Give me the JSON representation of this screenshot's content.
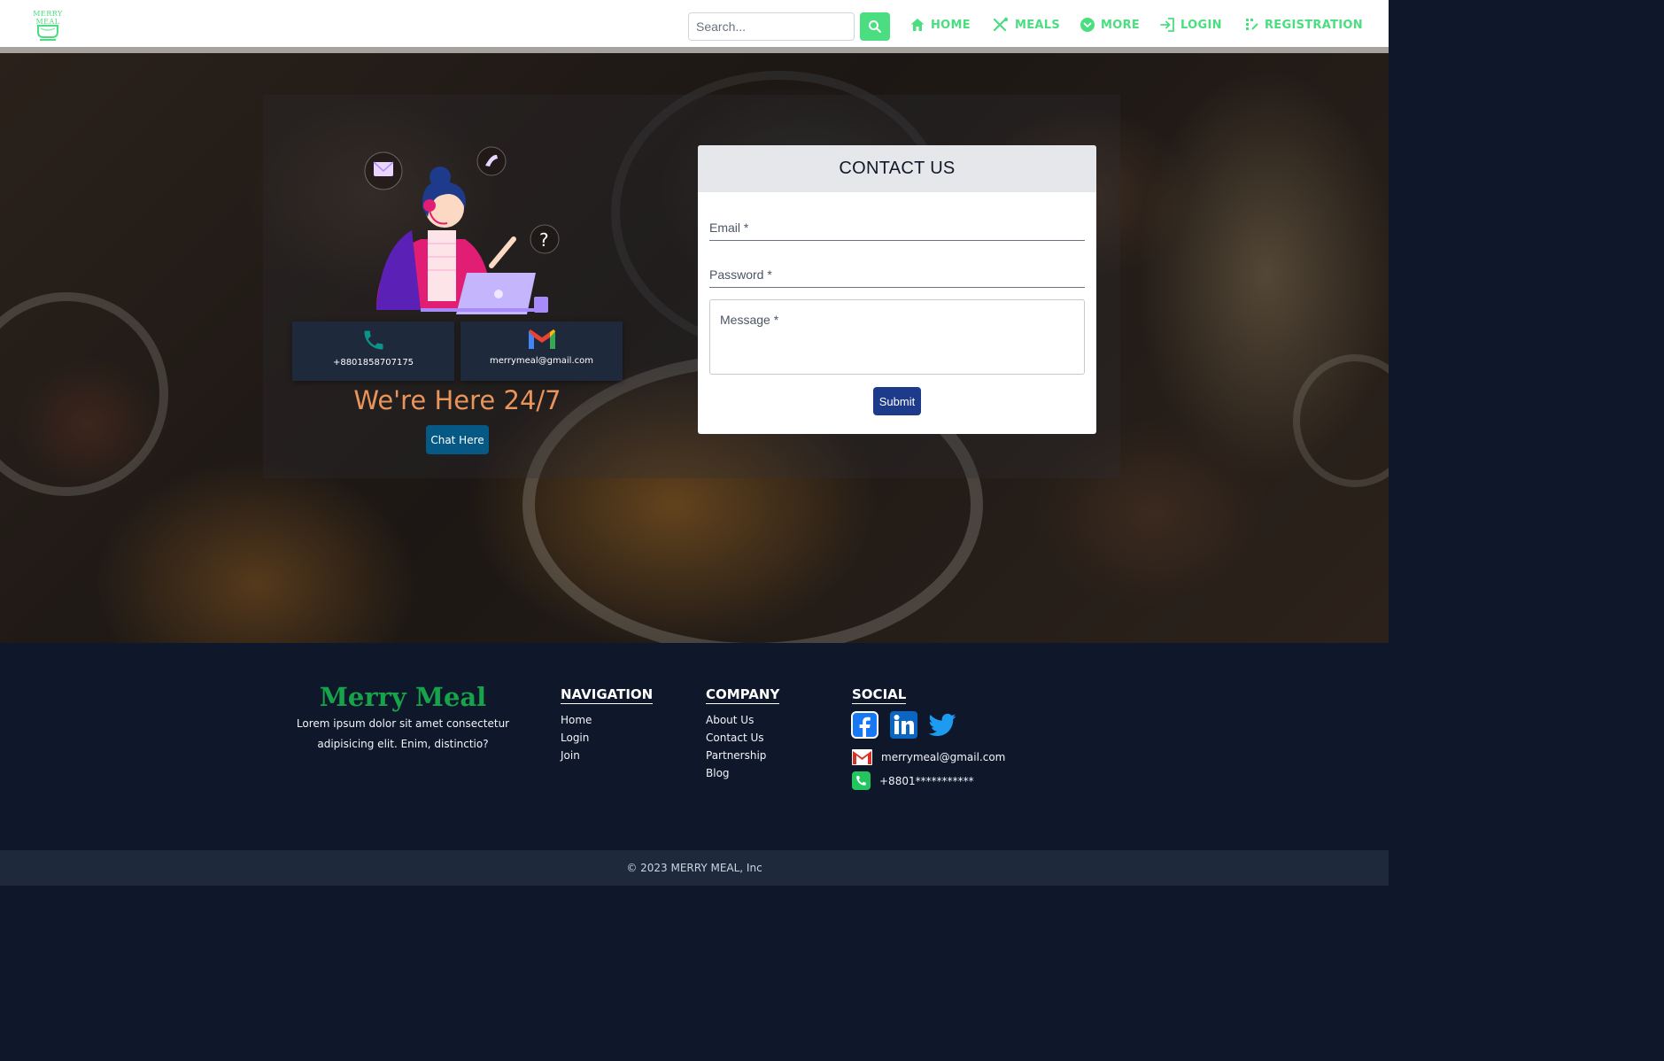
{
  "header": {
    "logo_text": "MERRY MEAL",
    "search": {
      "placeholder": "Search..."
    },
    "nav": [
      {
        "label": "HOME",
        "icon": "home-icon"
      },
      {
        "label": "MEALS",
        "icon": "utensils-icon"
      },
      {
        "label": "MORE",
        "icon": "chevron-down-circle-icon"
      },
      {
        "label": "LOGIN",
        "icon": "login-icon"
      },
      {
        "label": "REGISTRATION",
        "icon": "registration-icon"
      }
    ],
    "accent_color": "#4ade80"
  },
  "contact_info": {
    "phone": "+8801858707175",
    "email": "merrymeal@gmail.com",
    "heading": "We're Here 24/7",
    "chat_button": "Chat Here"
  },
  "form": {
    "title": "CONTACT US",
    "email_label": "Email *",
    "password_label": "Password *",
    "message_placeholder": "Message *",
    "submit_label": "Submit"
  },
  "footer": {
    "brand": "Merry Meal",
    "description": "Lorem ipsum dolor sit amet consectetur adipisicing elit. Enim, distinctio?",
    "navigation": {
      "title": "NAVIGATION",
      "items": [
        "Home",
        "Login",
        "Join"
      ]
    },
    "company": {
      "title": "COMPANY",
      "items": [
        "About Us",
        "Contact Us",
        "Partnership",
        "Blog"
      ]
    },
    "social": {
      "title": "SOCIAL",
      "icons": [
        "facebook-icon",
        "linkedin-icon",
        "twitter-icon"
      ],
      "email": "merrymeal@gmail.com",
      "phone": "+8801***********"
    },
    "copyright": "© 2023 MERRY MEAL, Inc"
  }
}
